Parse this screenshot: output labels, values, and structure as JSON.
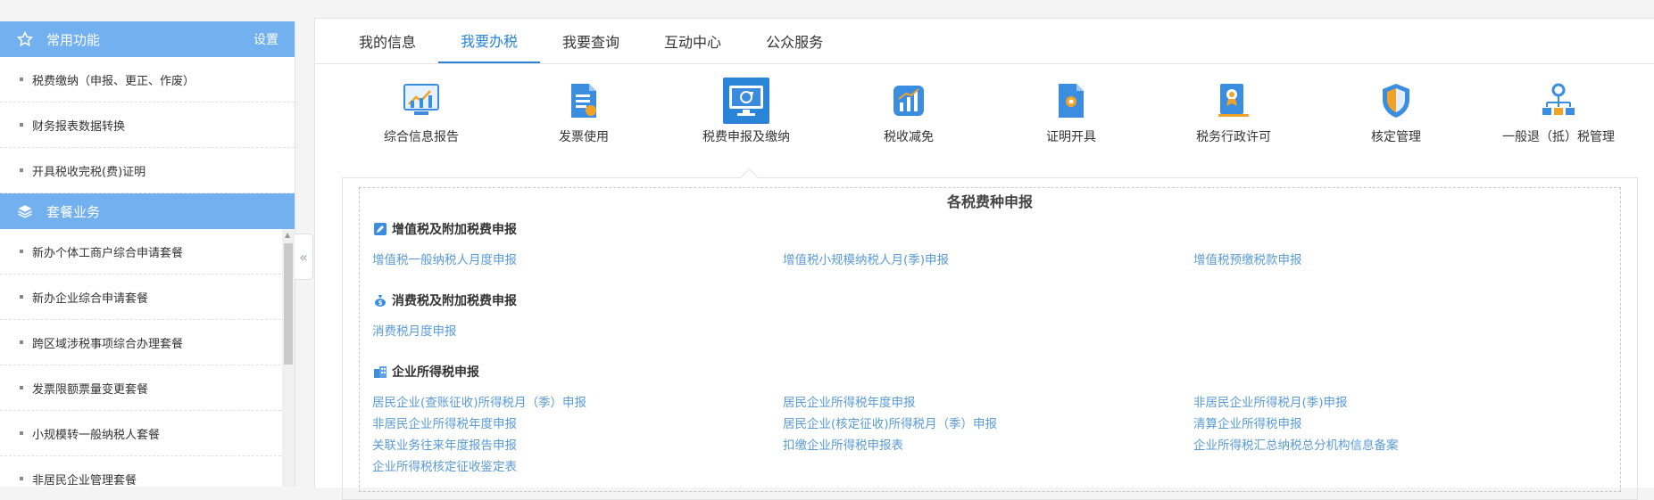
{
  "sidebar": {
    "common": {
      "title": "常用功能",
      "settings": "设置"
    },
    "common_items": [
      "税费缴纳（申报、更正、作废）",
      "财务报表数据转换",
      "开具税收完税(费)证明"
    ],
    "package": {
      "title": "套餐业务"
    },
    "package_items": [
      "新办个体工商户综合申请套餐",
      "新办企业综合申请套餐",
      "跨区域涉税事项综合办理套餐",
      "发票限额票量变更套餐",
      "小规模转一般纳税人套餐",
      "非居民企业管理套餐"
    ]
  },
  "tabs": [
    "我的信息",
    "我要办税",
    "我要查询",
    "互动中心",
    "公众服务"
  ],
  "active_tab": "我要办税",
  "categories": [
    "综合信息报告",
    "发票使用",
    "税费申报及缴纳",
    "税收减免",
    "证明开具",
    "税务行政许可",
    "核定管理",
    "一般退（抵）税管理"
  ],
  "active_category": "税费申报及缴纳",
  "panel": {
    "title": "各税费种申报",
    "groups": [
      {
        "title": "增值税及附加税费申报",
        "links": [
          "增值税一般纳税人月度申报",
          "增值税小规模纳税人月(季)申报",
          "增值税预缴税款申报"
        ]
      },
      {
        "title": "消费税及附加税费申报",
        "links": [
          "消费税月度申报"
        ]
      },
      {
        "title": "企业所得税申报",
        "links": [
          "居民企业(查账征收)所得税月（季）申报",
          "居民企业所得税年度申报",
          "非居民企业所得税月(季)申报",
          "非居民企业所得税年度申报",
          "居民企业(核定征收)所得税月（季）申报",
          "清算企业所得税申报",
          "关联业务往来年度报告申报",
          "扣缴企业所得税申报表",
          "企业所得税汇总纳税总分机构信息备案",
          "企业所得税核定征收鉴定表"
        ]
      }
    ]
  },
  "colors": {
    "accent": "#2a84d8",
    "sidebar_header": "#72b0ef",
    "link": "#5a9bd6"
  }
}
